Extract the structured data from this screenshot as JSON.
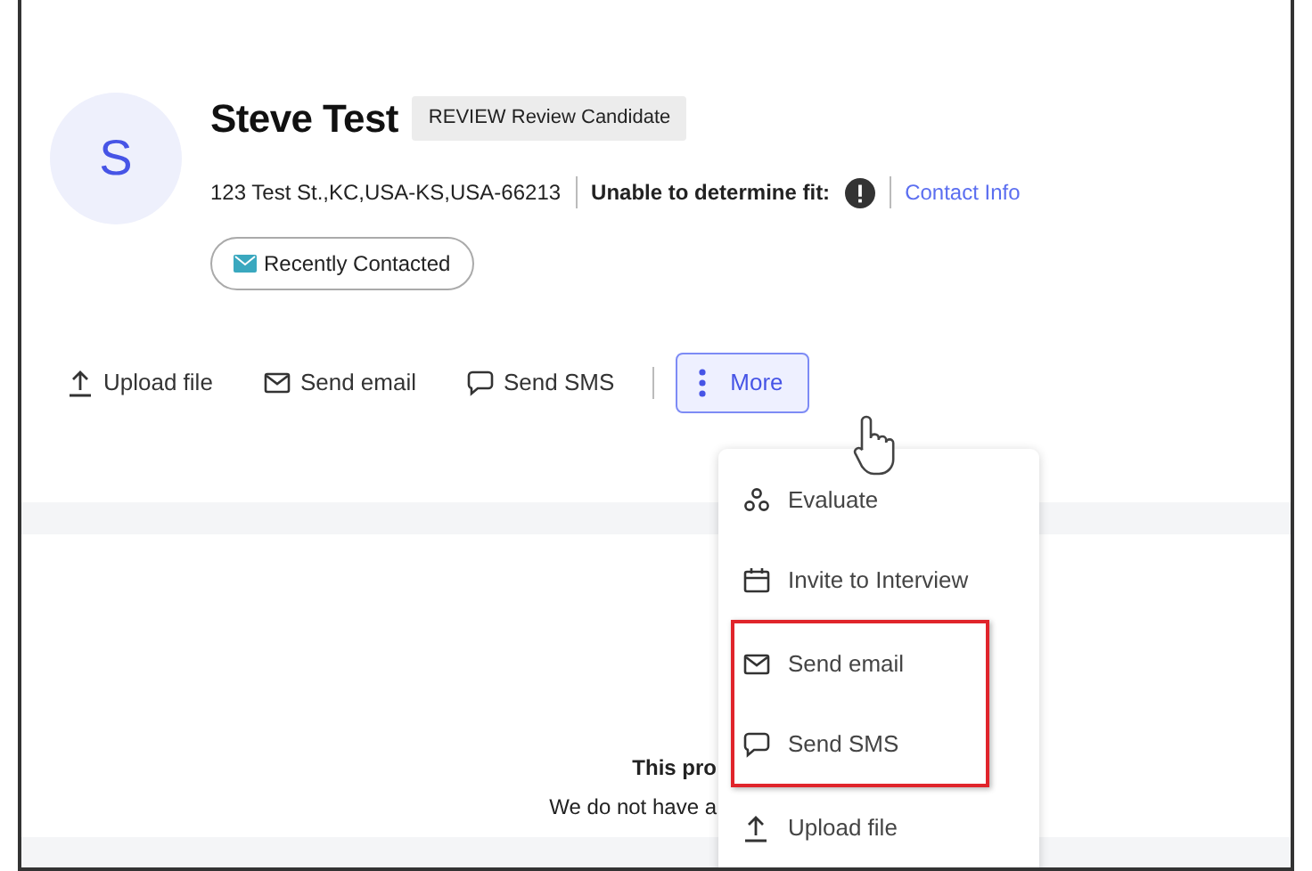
{
  "candidate": {
    "initial": "S",
    "name": "Steve Test",
    "status_code": "REVIEW",
    "status_label": "Review Candidate",
    "address": "123 Test St.,KC,USA-KS,USA-66213",
    "fit_label": "Unable to determine fit:",
    "contact_link": "Contact Info",
    "tag": "Recently Contacted"
  },
  "actions": [
    {
      "kind": "upload",
      "label": "Upload file"
    },
    {
      "kind": "email",
      "label": "Send email"
    },
    {
      "kind": "sms",
      "label": "Send SMS"
    }
  ],
  "more_button": {
    "label": "More",
    "expanded": true
  },
  "menu": [
    {
      "kind": "evaluate",
      "label": "Evaluate",
      "highlighted": false
    },
    {
      "kind": "calendar",
      "label": "Invite to Interview",
      "highlighted": false
    },
    {
      "kind": "email",
      "label": "Send email",
      "highlighted": true
    },
    {
      "kind": "sms",
      "label": "Send SMS",
      "highlighted": true
    },
    {
      "kind": "upload",
      "label": "Upload file",
      "highlighted": false
    }
  ],
  "empty_state": {
    "title": "This pro",
    "message": "We do not have a"
  }
}
